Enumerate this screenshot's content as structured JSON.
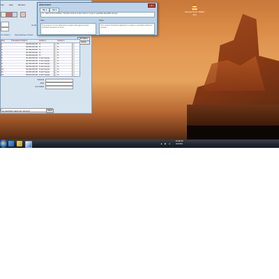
{
  "desktop": {
    "vlc_label": "Second Rock\nVIDEO App"
  },
  "app": {
    "menu": [
      "File",
      "Help",
      "Window"
    ],
    "link_left": "ort Ordem",
    "link_right": "Spreadsheet Ordem",
    "side_link": "Upda",
    "grid": {
      "headers": [
        "Item",
        "Transaction Order #",
        "Activity 1",
        "Activity 2"
      ],
      "rows": [
        {
          "item": "1",
          "order": "$0,000,000.00",
          "a1": "% ",
          "a2": "%"
        },
        {
          "item": "2",
          "order": "$0,000,000.00",
          "a1": "% ",
          "a2": "%"
        },
        {
          "item": "3",
          "order": "$7,000,000.00",
          "a1": "% ",
          "a2": "%"
        },
        {
          "item": "4",
          "order": "$3,000,000.00",
          "a1": "% ",
          "a2": "%"
        },
        {
          "item": "5",
          "order": "$0,000,000.00",
          "a1": "% ",
          "a2": "%"
        },
        {
          "item": "6",
          "order": "$1,000,000.00",
          "a1": "% Ext Supply",
          "a2": "%"
        },
        {
          "item": "7",
          "order": "$0,000,000.00",
          "a1": "% Ext Supply",
          "a2": "%"
        },
        {
          "item": "8",
          "order": "$7,000,000.00",
          "a1": "% Ext Supply",
          "a2": "%"
        },
        {
          "item": "9",
          "order": "$0,000,000.00",
          "a1": "% Ext Supply",
          "a2": "%"
        },
        {
          "item": "10",
          "order": "$0,000,000.00",
          "a1": "% Ext Supply",
          "a2": "%"
        },
        {
          "item": "11",
          "order": "$0,000,000.00",
          "a1": "% Ext Supply",
          "a2": "%"
        },
        {
          "item": "12",
          "order": "$0,000,000.00",
          "a1": "% Ext Supply",
          "a2": "%"
        }
      ],
      "btn_top": "All Orders",
      "btn_second": "Delete"
    },
    "totals": [
      {
        "label": "Subtotal",
        "value": ""
      },
      {
        "label": "Total",
        "value": ""
      },
      {
        "label": "Amt Added",
        "value": ""
      }
    ],
    "status_text": "at specified maximum amount",
    "status_button": "Close"
  },
  "dialog": {
    "title": "Attachment",
    "close_label": "X",
    "tabs": [
      "Tab 1",
      "Tab 2"
    ],
    "description": "Tx - Add record condition. Transfer amount to Item Note or move to specified allowable amount",
    "label_left": "Note",
    "label_right": "Notes",
    "box_left_text": "This amount is to be adjusted to a place that approval gets specified maximum amount",
    "box_right_text": "This amount should be adjusted to a place to specified maximum amount"
  },
  "taskbar": {
    "clock_time": "10:38 AM",
    "clock_date": "2/1/2011"
  },
  "colors": {
    "accent": "#2b4d8c",
    "grid_red_text": "#aa0000",
    "dialog_bg": "#bcd3ea",
    "taskbar": "#1f2530"
  },
  "icons": [
    "vlc-icon",
    "windows-start-icon",
    "ie-icon",
    "folder-icon",
    "media-player-icon",
    "flag-icon",
    "network-icon",
    "volume-icon"
  ]
}
